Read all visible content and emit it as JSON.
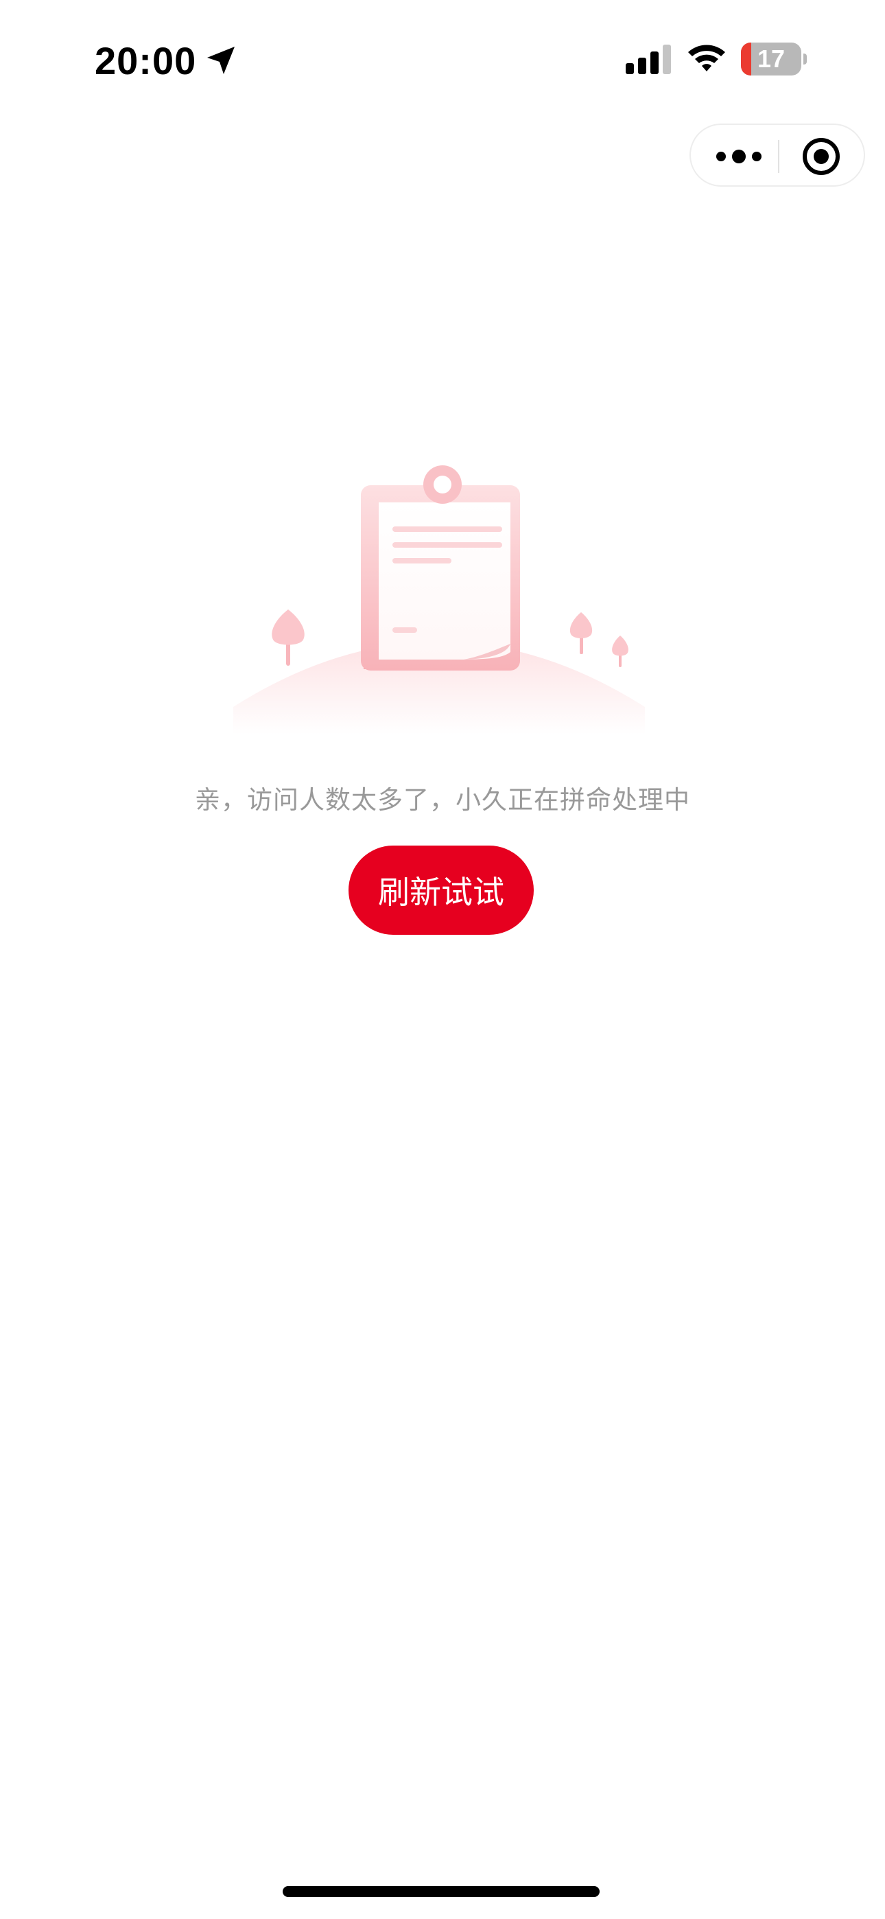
{
  "status_bar": {
    "time": "20:00",
    "battery_level": "17",
    "battery_fraction": 0.17,
    "icons": [
      "location-arrow-icon",
      "cellular-signal-icon",
      "wifi-icon",
      "battery-icon"
    ]
  },
  "capsule": {
    "more_icon": "more-dots-icon",
    "close_icon": "target-close-icon"
  },
  "illustration": {
    "icon": "empty-clipboard-illustration"
  },
  "content": {
    "message": "亲，访问人数太多了，小久正在拼命处理中",
    "refresh_label": "刷新试试"
  },
  "colors": {
    "accent": "#e6001f",
    "message_text": "#999999",
    "illustration_pink": "#fbc4c8",
    "battery_low": "#eb3b30"
  }
}
